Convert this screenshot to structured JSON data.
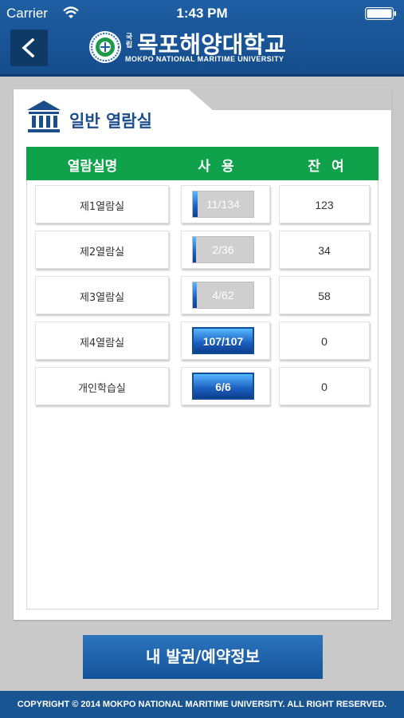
{
  "status_bar": {
    "carrier": "Carrier",
    "time": "1:43 PM"
  },
  "header": {
    "university_prefix": "국립",
    "university_name": "목포해양대학교",
    "university_name_en": "MOKPO NATIONAL MARITIME UNIVERSITY"
  },
  "section": {
    "title": "일반 열람실"
  },
  "table": {
    "headers": {
      "name": "열람실명",
      "used": "사용",
      "remaining": "잔여"
    },
    "rows": [
      {
        "name": "제1열람실",
        "usage": "11/134",
        "usage_ratio": 0.082,
        "remaining": "123"
      },
      {
        "name": "제2열람실",
        "usage": "2/36",
        "usage_ratio": 0.056,
        "remaining": "34"
      },
      {
        "name": "제3열람실",
        "usage": "4/62",
        "usage_ratio": 0.065,
        "remaining": "58"
      },
      {
        "name": "제4열람실",
        "usage": "107/107",
        "usage_ratio": 1.0,
        "remaining": "0"
      },
      {
        "name": "개인학습실",
        "usage": "6/6",
        "usage_ratio": 1.0,
        "remaining": "0"
      }
    ]
  },
  "reserve_button": {
    "label": "내 발권/예약정보"
  },
  "footer": {
    "copyright": "COPYRIGHT © 2014 MOKPO NATIONAL MARITIME UNIVERSITY. ALL RIGHT RESERVED."
  },
  "colors": {
    "header_blue": "#1f5fa3",
    "table_header_green": "#10a24a",
    "usage_fill_blue": "#1a5fbf",
    "button_blue": "#14539a"
  },
  "icons": {
    "wifi": "wifi-icon",
    "battery": "battery-icon",
    "back": "chevron-left-icon",
    "logo": "university-emblem-icon",
    "section": "library-building-icon"
  }
}
